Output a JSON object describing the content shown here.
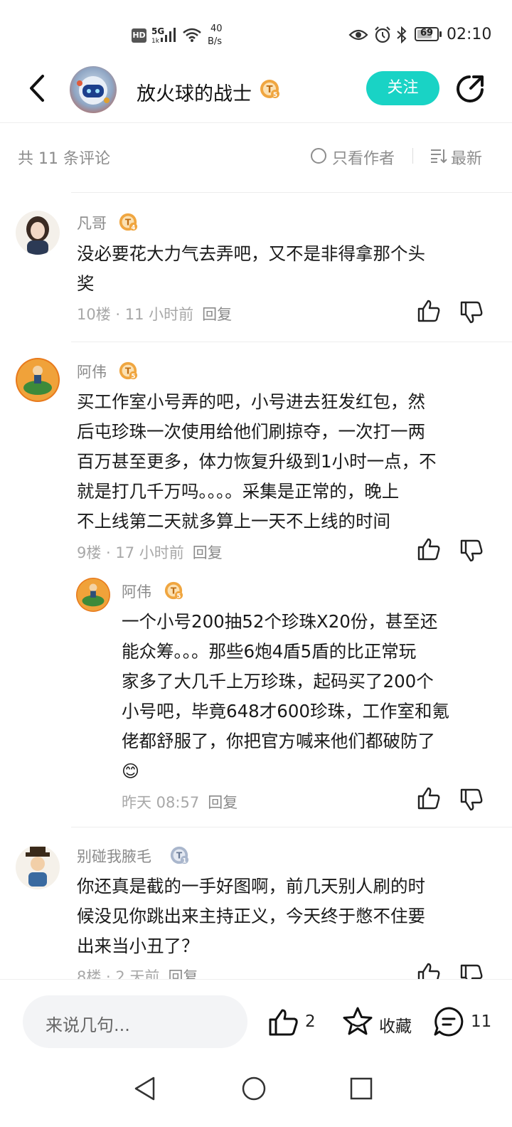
{
  "status_bar": {
    "hd": "HD",
    "net_5g": "5G",
    "net_sub": "1k",
    "speed_value": "40",
    "speed_unit": "B/s",
    "battery": "69",
    "time": "02:10"
  },
  "header": {
    "title": "放火球的战士",
    "level": "T5",
    "follow_label": "关注"
  },
  "comments_bar": {
    "count_label": "共 11 条评论",
    "author_only_label": "只看作者",
    "sort_label": "最新"
  },
  "comments": [
    {
      "user": "凡哥",
      "level": "T4",
      "content_lines": [
        "没必要花大力气去弄吧，又不是非得拿那个头",
        "奖"
      ],
      "floor_time": "10楼 · 11 小时前",
      "reply_label": "回复"
    },
    {
      "user": "阿伟",
      "level": "T5",
      "content_lines": [
        "买工作室小号弄的吧，小号进去狂发红包，然",
        "后屯珍珠一次使用给他们刷掠夺，一次打一两",
        "百万甚至更多，体力恢复升级到1小时一点，不",
        "就是打几千万吗。。。。采集是正常的，晚上",
        "不上线第二天就多算上一天不上线的时间"
      ],
      "floor_time": "9楼 · 17 小时前",
      "reply_label": "回复",
      "reply": {
        "user": "阿伟",
        "level": "T5",
        "content_lines": [
          "一个小号200抽52个珍珠X20份，甚至还",
          "能众筹。。。那些6炮4盾5盾的比正常玩",
          "家多了大几千上万珍珠，起码买了200个",
          "小号吧，毕竟648才600珍珠，工作室和氪",
          "佬都舒服了，你把官方喊来他们都破防了"
        ],
        "emoji": "😊",
        "time": "昨天 08:57",
        "reply_label": "回复"
      }
    },
    {
      "user": "别碰我腋毛",
      "level": "T1",
      "content_lines": [
        "你还真是截的一手好图啊，前几天别人刷的时",
        "候没见你跳出来主持正义，今天终于憋不住要",
        "出来当小丑了？"
      ],
      "floor_time": "8楼 · 2 天前",
      "reply_label": "回复"
    }
  ],
  "bottom_bar": {
    "input_placeholder": "来说几句...",
    "like_count": "2",
    "favorite_label": "收藏",
    "comment_count": "11"
  },
  "colors": {
    "accent": "#19d3c5",
    "badge": "#f0a640",
    "meta_gray": "#a8a8a8"
  }
}
